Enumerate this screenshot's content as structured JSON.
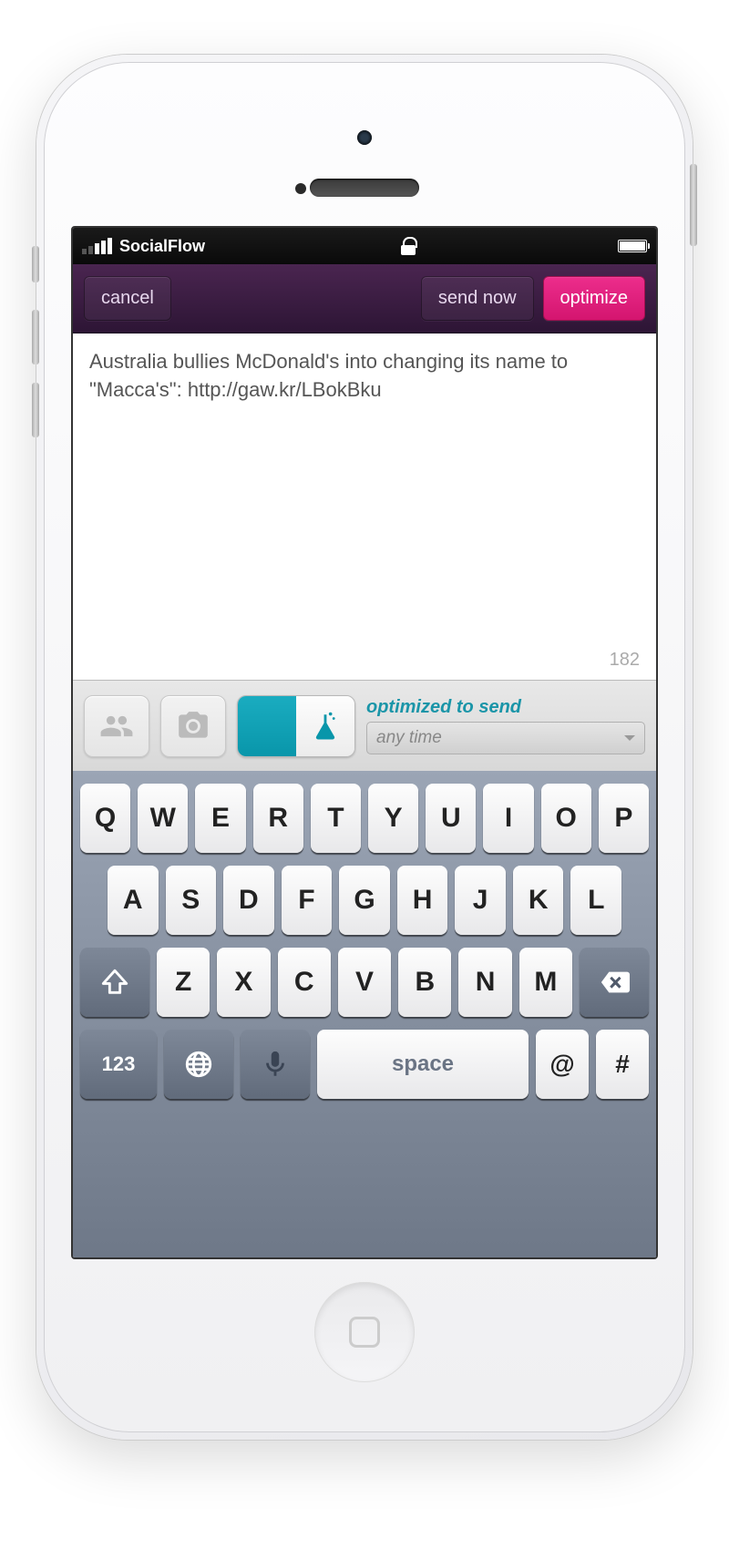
{
  "status": {
    "carrier": "SocialFlow"
  },
  "nav": {
    "cancel": "cancel",
    "send_now": "send now",
    "optimize": "optimize"
  },
  "compose": {
    "text": "Australia bullies McDonald's into changing its name to \"Macca's\": http://gaw.kr/LBokBku",
    "char_count": "182"
  },
  "toolbar": {
    "opt_label": "optimized to send",
    "dropdown": "any time"
  },
  "keyboard": {
    "row1": [
      "Q",
      "W",
      "E",
      "R",
      "T",
      "Y",
      "U",
      "I",
      "O",
      "P"
    ],
    "row2": [
      "A",
      "S",
      "D",
      "F",
      "G",
      "H",
      "J",
      "K",
      "L"
    ],
    "row3": [
      "Z",
      "X",
      "C",
      "V",
      "B",
      "N",
      "M"
    ],
    "num": "123",
    "space": "space",
    "at": "@",
    "hash": "#"
  }
}
